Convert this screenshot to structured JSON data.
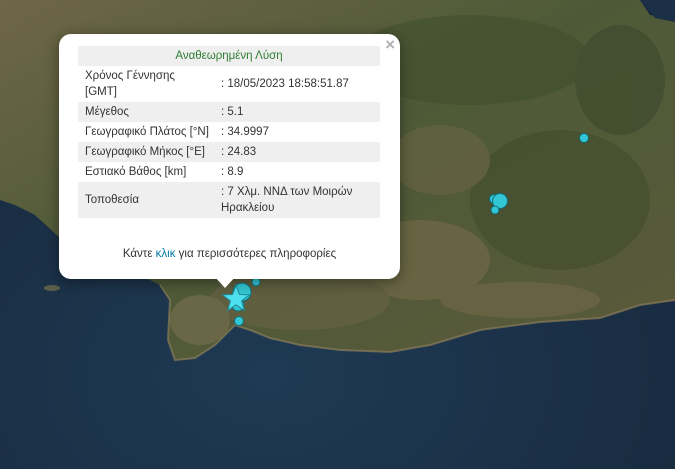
{
  "popup": {
    "close": "×",
    "header": "Αναθεωρημένη Λύση",
    "rows": [
      {
        "label": "Χρόνος Γέννησης [GMT]",
        "value": ": 18/05/2023 18:58:51.87"
      },
      {
        "label": "Μέγεθος",
        "value": ": 5.1"
      },
      {
        "label": "Γεωγραφικό Πλάτος [°N]",
        "value": ": 34.9997"
      },
      {
        "label": "Γεωγραφικό Μήκος [°E]",
        "value": ": 24.83"
      },
      {
        "label": "Εστιακό Βάθος [km]",
        "value": ": 8.9"
      },
      {
        "label": "Τοποθεσία",
        "value": ": 7 Χλμ. ΝΝΔ των Μοιρών Ηρακλείου"
      }
    ],
    "more_prefix": "Κάντε ",
    "more_link": "κλικ",
    "more_suffix": " για περισσότερες πληροφορίες"
  },
  "map": {
    "colors": {
      "sea": "#1c3349",
      "land": "#5c5a3a",
      "marker": "#33c6d4",
      "marker_stroke": "#0f6f7a",
      "star": "#4fe0ef"
    }
  }
}
